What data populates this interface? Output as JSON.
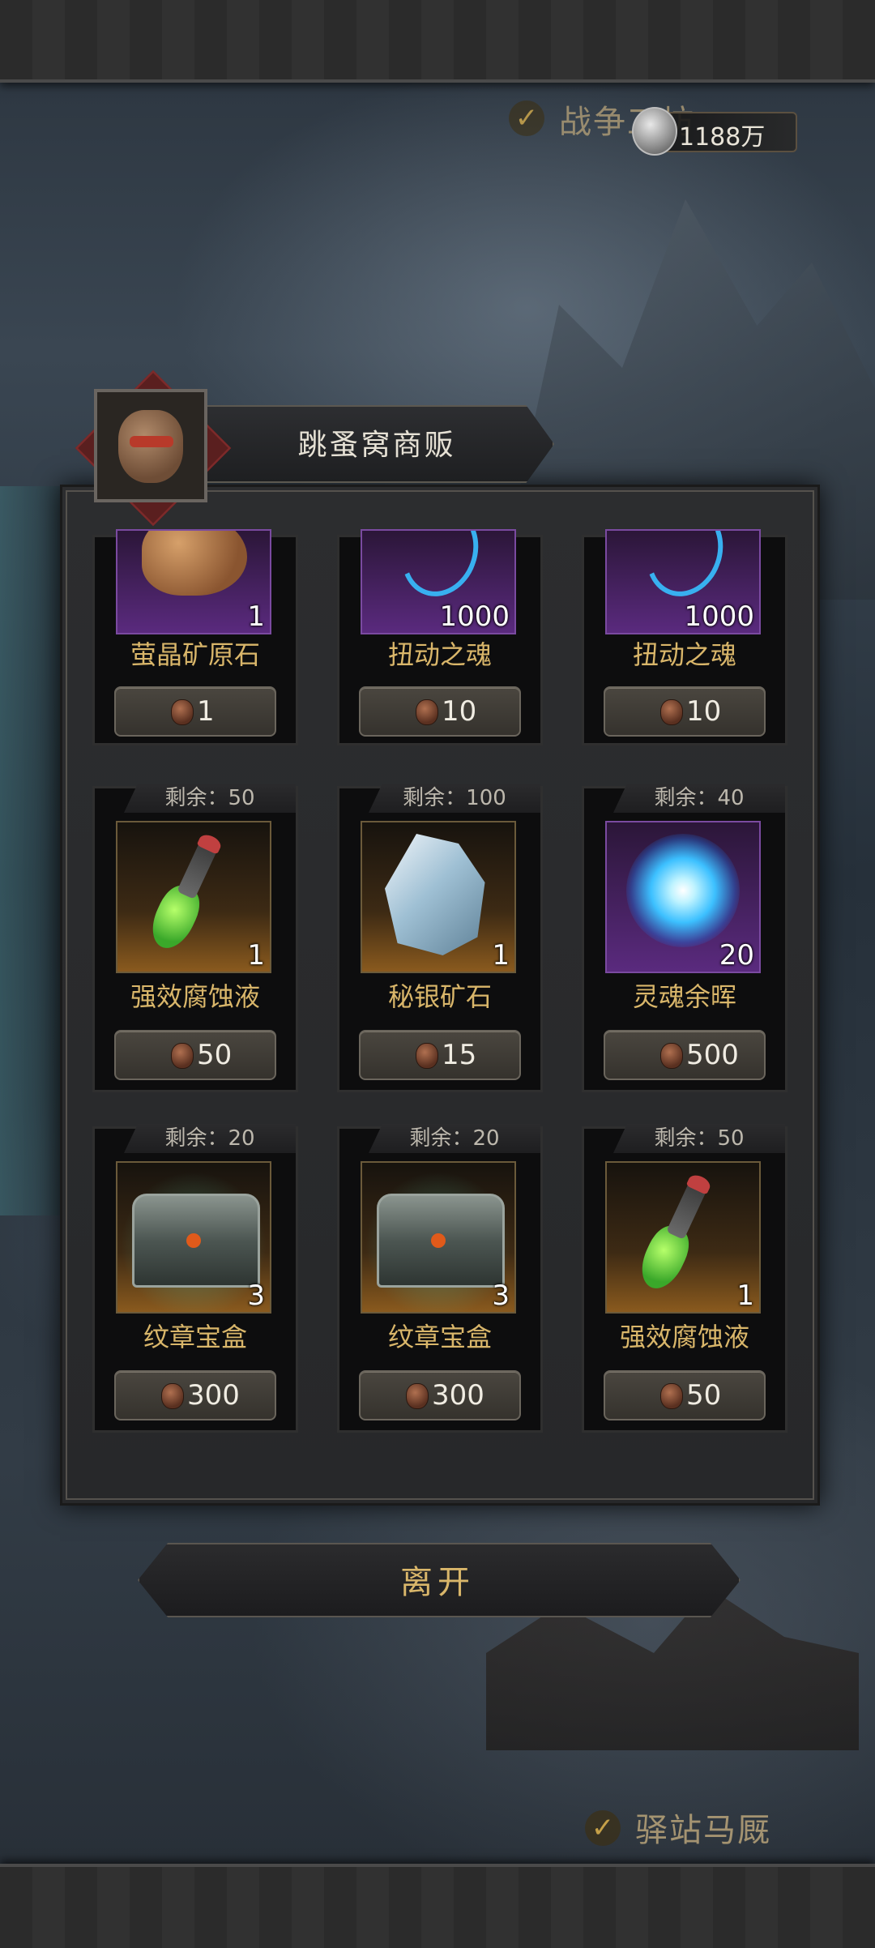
{
  "header": {
    "quest_label": "战争工坊",
    "currency": {
      "icon": "silver-coin-icon",
      "value": "1188万"
    }
  },
  "shop": {
    "title": "跳蚤窝商贩",
    "remaining_prefix": "剩余：",
    "items": [
      {
        "name": "萤晶矿原石",
        "qty": "1",
        "price": "1",
        "remaining": "",
        "rarity": "purple",
        "icon": "ore-icon"
      },
      {
        "name": "扭动之魂",
        "qty": "1000",
        "price": "10",
        "remaining": "",
        "rarity": "purple",
        "icon": "soul-swirl-icon"
      },
      {
        "name": "扭动之魂",
        "qty": "1000",
        "price": "10",
        "remaining": "",
        "rarity": "purple",
        "icon": "soul-swirl-icon"
      },
      {
        "name": "强效腐蚀液",
        "qty": "1",
        "price": "50",
        "remaining": "剩余：50",
        "rarity": "orange",
        "icon": "potion-icon"
      },
      {
        "name": "秘银矿石",
        "qty": "1",
        "price": "15",
        "remaining": "剩余：100",
        "rarity": "orange",
        "icon": "crystal-icon"
      },
      {
        "name": "灵魂余晖",
        "qty": "20",
        "price": "500",
        "remaining": "剩余：40",
        "rarity": "purple",
        "icon": "soul-orb-icon"
      },
      {
        "name": "纹章宝盒",
        "qty": "3",
        "price": "300",
        "remaining": "剩余：20",
        "rarity": "orange",
        "icon": "chest-icon"
      },
      {
        "name": "纹章宝盒",
        "qty": "3",
        "price": "300",
        "remaining": "剩余：20",
        "rarity": "orange",
        "icon": "chest-icon"
      },
      {
        "name": "强效腐蚀液",
        "qty": "1",
        "price": "50",
        "remaining": "剩余：50",
        "rarity": "orange",
        "icon": "potion-icon"
      }
    ],
    "price_currency_icon": "seed-icon"
  },
  "leave_button": {
    "label": "离开"
  },
  "footer": {
    "quest_label": "驿站马厩"
  },
  "colors": {
    "accent_gold": "#d9b66a",
    "rarity_purple": "#5a2a7e",
    "rarity_orange": "#8a5a1e"
  }
}
